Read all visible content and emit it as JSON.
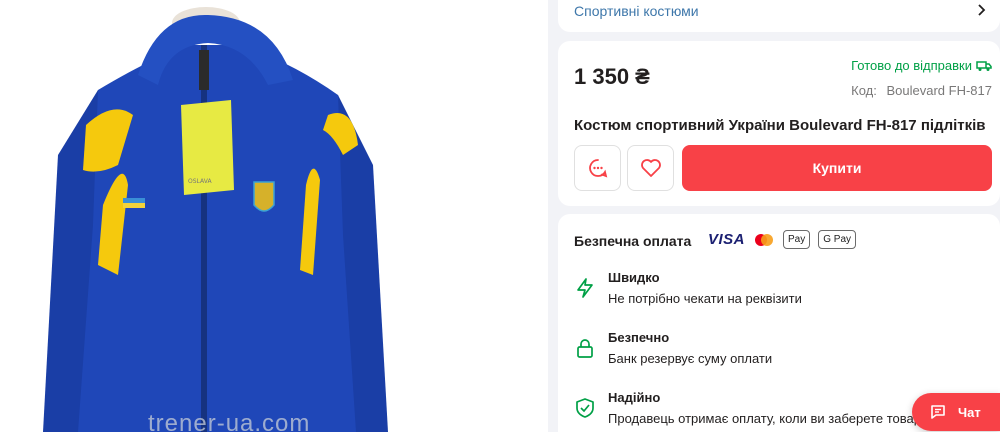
{
  "gallery": {
    "watermark": "trener-ua.com"
  },
  "category": {
    "label": "Спортивні костюми"
  },
  "product": {
    "price": "1 350 ₴",
    "status": "Готово до відправки",
    "code_label": "Код:",
    "code_value": "Boulevard FH-817",
    "title": "Костюм спортивний України Boulevard FH-817 підлітків",
    "buy_label": "Купити"
  },
  "payment": {
    "title": "Безпечна оплата",
    "visa": "VISA",
    "apple_pay": " Pay",
    "google_pay": "G Pay",
    "features": [
      {
        "title": "Швидко",
        "desc": "Не потрібно чекати на реквізити",
        "icon": "lightning-icon"
      },
      {
        "title": "Безпечно",
        "desc": "Банк резервує суму оплати",
        "icon": "lock-icon"
      },
      {
        "title": "Надійно",
        "desc": "Продавець отримає оплату, коли ви заберете товар",
        "icon": "shield-check-icon"
      }
    ]
  },
  "chat": {
    "label": "Чат"
  },
  "colors": {
    "accent_red": "#f84147",
    "green": "#00a046",
    "link_blue": "#3e77aa"
  }
}
